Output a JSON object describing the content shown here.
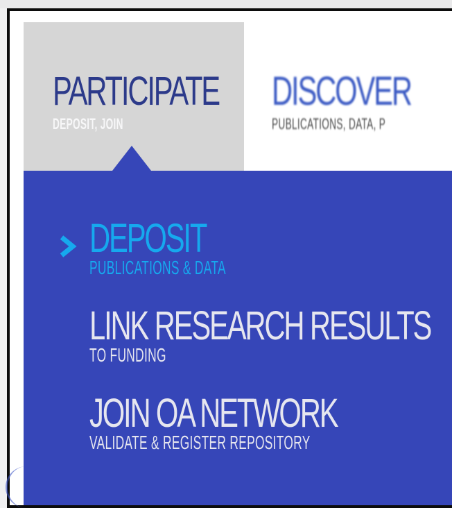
{
  "nav": {
    "tabs": [
      {
        "title": "PARTICIPATE",
        "subtitle": "DEPOSIT, JOIN",
        "active": true
      },
      {
        "title": "DISCOVER",
        "subtitle": "PUBLICATIONS, DATA, P",
        "active": false
      }
    ]
  },
  "dropdown": {
    "items": [
      {
        "title": "DEPOSIT",
        "subtitle": "PUBLICATIONS & DATA",
        "selected": true
      },
      {
        "title": "LINK RESEARCH RESULTS",
        "subtitle": "TO FUNDING",
        "selected": false
      },
      {
        "title": "JOIN OA NETWORK",
        "subtitle": "VALIDATE & REGISTER REPOSITORY",
        "selected": false
      }
    ],
    "selected_icon": "chevron-right-icon"
  },
  "colors": {
    "dropdown_bg": "#3646b8",
    "active_tab_bg": "#d6d6d6",
    "active_tab_title": "#2c3a8a",
    "selected_item": "#16a9ee",
    "item_text": "#e6e6ef",
    "discover_title": "#3c5bc4",
    "frame_border": "#0c0c0c"
  }
}
